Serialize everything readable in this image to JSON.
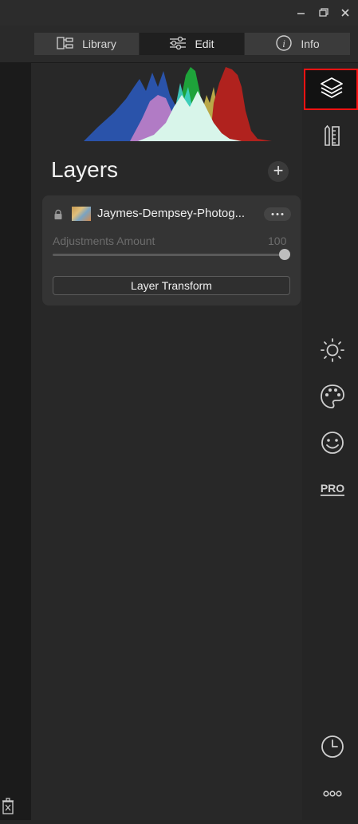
{
  "tabs": [
    {
      "label": "Library",
      "icon": "library-icon",
      "active": false
    },
    {
      "label": "Edit",
      "icon": "sliders-icon",
      "active": true
    },
    {
      "label": "Info",
      "icon": "info-icon",
      "active": false
    }
  ],
  "window_controls": [
    "minimize-icon",
    "restore-icon",
    "close-icon"
  ],
  "layers_panel": {
    "title": "Layers",
    "add_label": "+",
    "layer": {
      "name": "Jaymes-Dempsey-Photog...",
      "adjustments_label": "Adjustments Amount",
      "adjustments_value": "100",
      "transform_label": "Layer Transform"
    }
  },
  "right_sidebar": {
    "icons": [
      "layers-icon",
      "presets-icon",
      "essentials-icon",
      "creative-icon",
      "portrait-icon",
      "pro-icon",
      "history-icon",
      "more-icon"
    ],
    "pro_text": "PRO"
  },
  "colors": {
    "accent_highlight": "#ff1212",
    "histogram_blue": "#2a58b8",
    "histogram_green": "#1ea33a",
    "histogram_red": "#b0221e",
    "histogram_luma": "#d8f5ea"
  }
}
